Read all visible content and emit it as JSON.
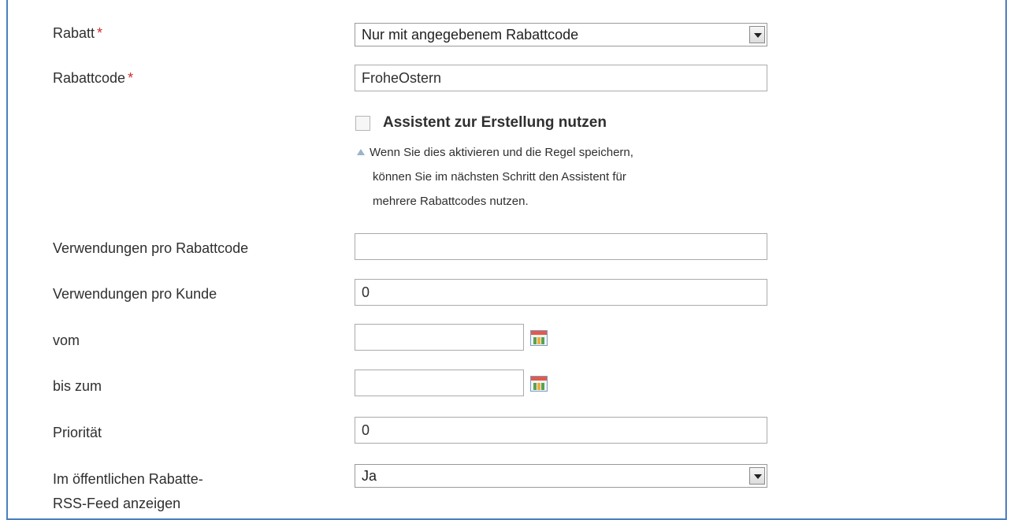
{
  "rabatt": {
    "label": "Rabatt",
    "required_mark": "*",
    "selected": "Nur mit angegebenem Rabattcode"
  },
  "rabattcode": {
    "label": "Rabattcode",
    "required_mark": "*",
    "value": "FroheOstern"
  },
  "assistent": {
    "label": "Assistent zur Erstellung nutzen",
    "checked": false,
    "hint_line1": "Wenn Sie dies aktivieren und die Regel speichern,",
    "hint_line2": "können Sie im nächsten Schritt den Assistent für",
    "hint_line3": "mehrere Rabattcodes nutzen."
  },
  "uses_per_code": {
    "label": "Verwendungen pro Rabattcode",
    "value": ""
  },
  "uses_per_customer": {
    "label": "Verwendungen pro Kunde",
    "value": "0"
  },
  "from_date": {
    "label": "vom",
    "value": "",
    "icon": "calendar-icon"
  },
  "to_date": {
    "label": "bis zum",
    "value": "",
    "icon": "calendar-icon"
  },
  "priority": {
    "label": "Priorität",
    "value": "0"
  },
  "rss": {
    "label_line1": "Im öffentlichen Rabatte-",
    "label_line2": "RSS-Feed anzeigen",
    "selected": "Ja"
  }
}
